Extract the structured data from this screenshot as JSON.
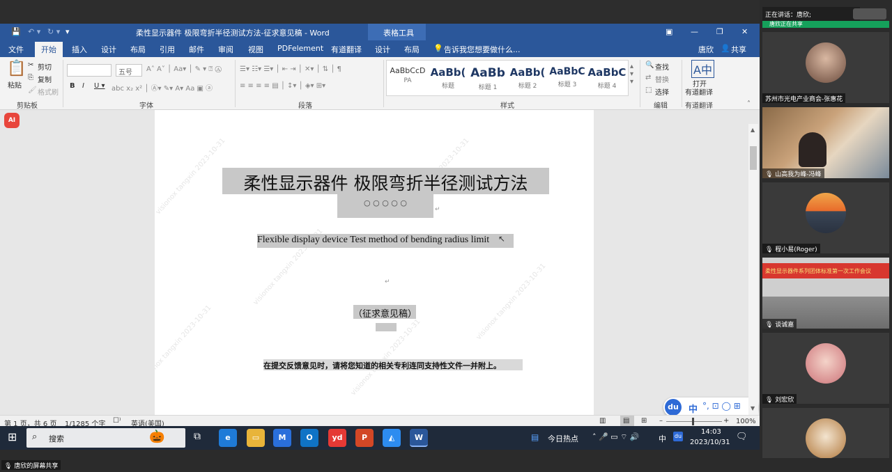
{
  "window": {
    "title": "柔性显示器件 极限弯折半径测试方法-征求意见稿 - Word",
    "context_tool": "表格工具",
    "tell_me": "告诉我您想要做什么...",
    "user": "唐欣",
    "share": "共享"
  },
  "tabs": [
    "文件",
    "开始",
    "插入",
    "设计",
    "布局",
    "引用",
    "邮件",
    "审阅",
    "视图",
    "PDFelement",
    "有道翻译",
    "设计",
    "布局"
  ],
  "ribbon": {
    "clipboard": {
      "paste": "粘贴",
      "cut": "剪切",
      "copy": "复制",
      "format_painter": "格式刷",
      "label": "剪贴板"
    },
    "font": {
      "size": "五号",
      "label": "字体"
    },
    "paragraph": {
      "label": "段落"
    },
    "styles": {
      "label": "样式",
      "items": [
        {
          "preview": "AaBbCcD",
          "name": "PA"
        },
        {
          "preview": "AaBb(",
          "name": "标题"
        },
        {
          "preview": "AaBb",
          "name": "标题 1"
        },
        {
          "preview": "AaBb(",
          "name": "标题 2"
        },
        {
          "preview": "AaBbC",
          "name": "标题 3"
        },
        {
          "preview": "AaBbC",
          "name": "标题 4"
        }
      ]
    },
    "editing": {
      "find": "查找",
      "replace": "替换",
      "select": "选择",
      "label": "编辑"
    },
    "translate": {
      "open": "打开",
      "name": "有道翻译",
      "label": "有道翻译"
    }
  },
  "document": {
    "title_cn": "柔性显示器件  极限弯折半径测试方法",
    "dots": "○   ○   ○   ○   ○",
    "title_en": "Flexible display device   Test method of bending radius limit",
    "draft": "（征求意见稿）",
    "notice": "在提交反馈意见时，请将您知道的相关专利连同支持性文件一并附上。",
    "watermark": "visionox tangxin 2023-10-31"
  },
  "ime": {
    "logo": "du",
    "lang": "中"
  },
  "statusbar": {
    "page": "第 1 页，共 6 页",
    "words": "1/1285 个字",
    "lang": "英语(美国)",
    "zoom": "100%"
  },
  "taskbar": {
    "search": "搜索",
    "news": "今日热点",
    "ime_lang": "中",
    "time": "14:03",
    "date": "2023/10/31"
  },
  "meeting": {
    "speaking": "正在讲话：唐欣;",
    "sharing_banner": "唐欣正在共享",
    "screen_share_label": "唐欣的屏幕共享",
    "participants": [
      {
        "name": "苏州市光电产业商会-张惠花"
      },
      {
        "name": "山高我为峰-冯峰"
      },
      {
        "name": "程小易(Roger)"
      },
      {
        "name": "谈诚嘉"
      },
      {
        "name": "刘宏欣"
      },
      {
        "name": ""
      }
    ],
    "room_banner": "柔性显示器件系列团体标准第一次工作会议"
  }
}
